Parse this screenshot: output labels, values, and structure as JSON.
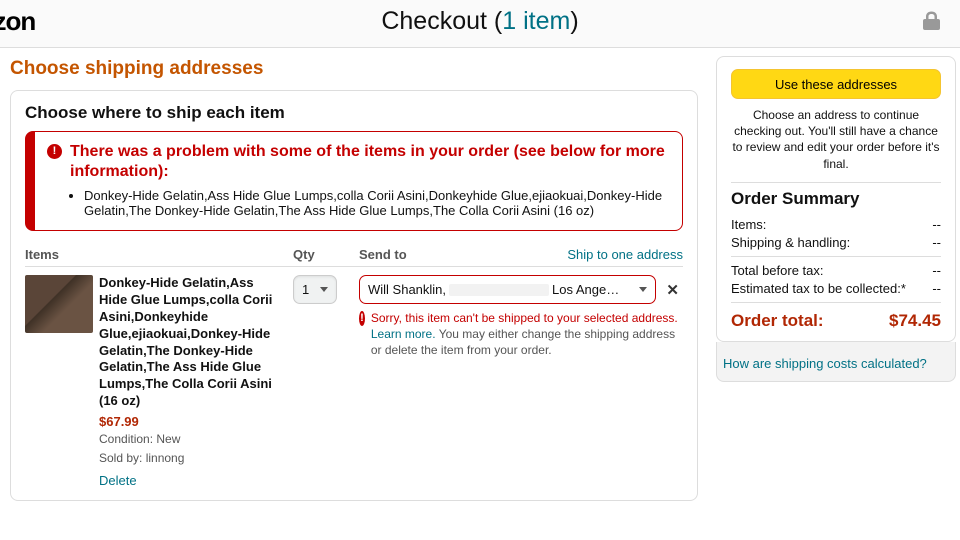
{
  "header": {
    "logo_text": "azon",
    "checkout_label": "Checkout",
    "item_count_label": "1 item"
  },
  "left": {
    "section_heading": "Choose shipping addresses",
    "panel_heading": "Choose where to ship each item",
    "alert": {
      "heading": "There was a problem with some of the items in your order (see below for more information):",
      "bullet": "Donkey-Hide Gelatin,Ass Hide Glue Lumps,colla Corii Asini,Donkeyhide Glue,ejiaokuai,Donkey-Hide Gelatin,The Donkey-Hide Gelatin,The Ass Hide Glue Lumps,The Colla Corii Asini (16 oz)"
    },
    "columns": {
      "items": "Items",
      "qty": "Qty",
      "send_to": "Send to",
      "ship_one": "Ship to one address"
    },
    "item": {
      "name": "Donkey-Hide Gelatin,Ass Hide Glue Lumps,colla Corii Asini,Donkeyhide Glue,ejiaokuai,Donkey-Hide Gelatin,The Donkey-Hide Gelatin,The Ass Hide Glue Lumps,The Colla Corii Asini (16 oz)",
      "price": "$67.99",
      "condition": "Condition: New",
      "sold_by": "Sold by: linnong",
      "delete_label": "Delete",
      "qty": "1",
      "address_name": "Will Shanklin, ",
      "address_city": "Los Ange…",
      "ship_error_lead": "Sorry, this item can't be shipped to your selected address.",
      "ship_error_link": "Learn more.",
      "ship_error_rest": " You may either change the shipping address or delete the item from your order."
    }
  },
  "right": {
    "button_label": "Use these addresses",
    "hint": "Choose an address to continue checking out. You'll still have a chance to review and edit your order before it's final.",
    "summary_title": "Order Summary",
    "lines": {
      "items_label": "Items:",
      "items_val": "--",
      "ship_label": "Shipping & handling:",
      "ship_val": "--",
      "before_tax_label": "Total before tax:",
      "before_tax_val": "--",
      "tax_label": "Estimated tax to be collected:*",
      "tax_val": "--"
    },
    "total_label": "Order total:",
    "total_val": "$74.45",
    "footer_link": "How are shipping costs calculated?"
  }
}
